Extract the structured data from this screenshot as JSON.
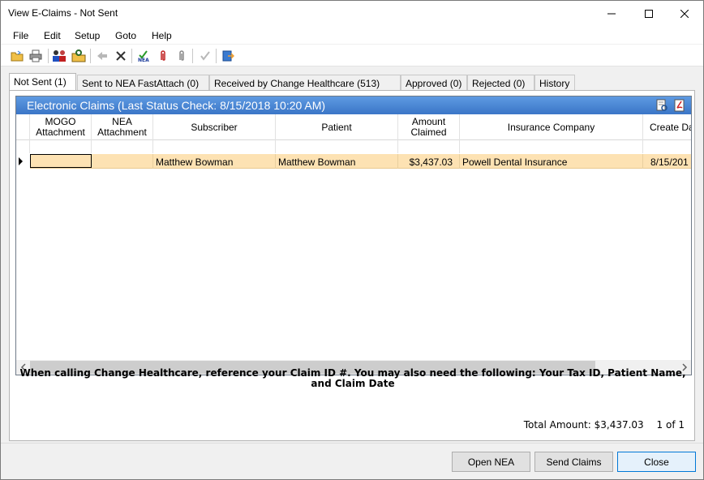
{
  "window": {
    "title": "View E-Claims - Not Sent"
  },
  "menu": [
    "File",
    "Edit",
    "Setup",
    "Goto",
    "Help"
  ],
  "toolbar_icons": [
    "open-folder-icon",
    "print-icon",
    "people-icon",
    "key-folder-icon",
    "back-arrow-icon",
    "delete-x-icon",
    "nea-check-icon",
    "paperclip-red-icon",
    "paperclip-gray-icon",
    "checkmark-icon",
    "export-icon"
  ],
  "tabs": [
    {
      "label": "Not Sent (1)",
      "active": true
    },
    {
      "label": "Sent to NEA FastAttach (0)"
    },
    {
      "label": "Received by Change Healthcare (513)"
    },
    {
      "label": "Approved (0)"
    },
    {
      "label": "Rejected (0)"
    },
    {
      "label": "History"
    }
  ],
  "grid": {
    "caption": "Electronic Claims (Last Status Check: 8/15/2018 10:20 AM)",
    "columns": [
      {
        "line1": "MOGO",
        "line2": "Attachment"
      },
      {
        "line1": "NEA",
        "line2": "Attachment"
      },
      {
        "line1": "Subscriber",
        "line2": ""
      },
      {
        "line1": "Patient",
        "line2": ""
      },
      {
        "line1": "Amount",
        "line2": "Claimed"
      },
      {
        "line1": "Insurance Company",
        "line2": ""
      },
      {
        "line1": "Create Da",
        "line2": ""
      }
    ],
    "rows": [
      {
        "mogo": "",
        "nea": "",
        "subscriber": "Matthew Bowman",
        "patient": "Matthew Bowman",
        "amount": "$3,437.03",
        "insurance": "Powell Dental Insurance",
        "create_date": "8/15/201"
      }
    ]
  },
  "notice": "When calling Change Healthcare, reference your Claim ID #. You may also need the following: Your Tax ID, Patient Name, and Claim Date",
  "footer": {
    "total": "Total Amount: $3,437.03",
    "paging": "1 of 1"
  },
  "buttons": {
    "open_nea": "Open NEA",
    "send_claims": "Send Claims",
    "close": "Close"
  },
  "colors": {
    "caption_blue": "#3b76c7",
    "selected_row": "#fde2b3",
    "default_button_border": "#0078d7"
  }
}
